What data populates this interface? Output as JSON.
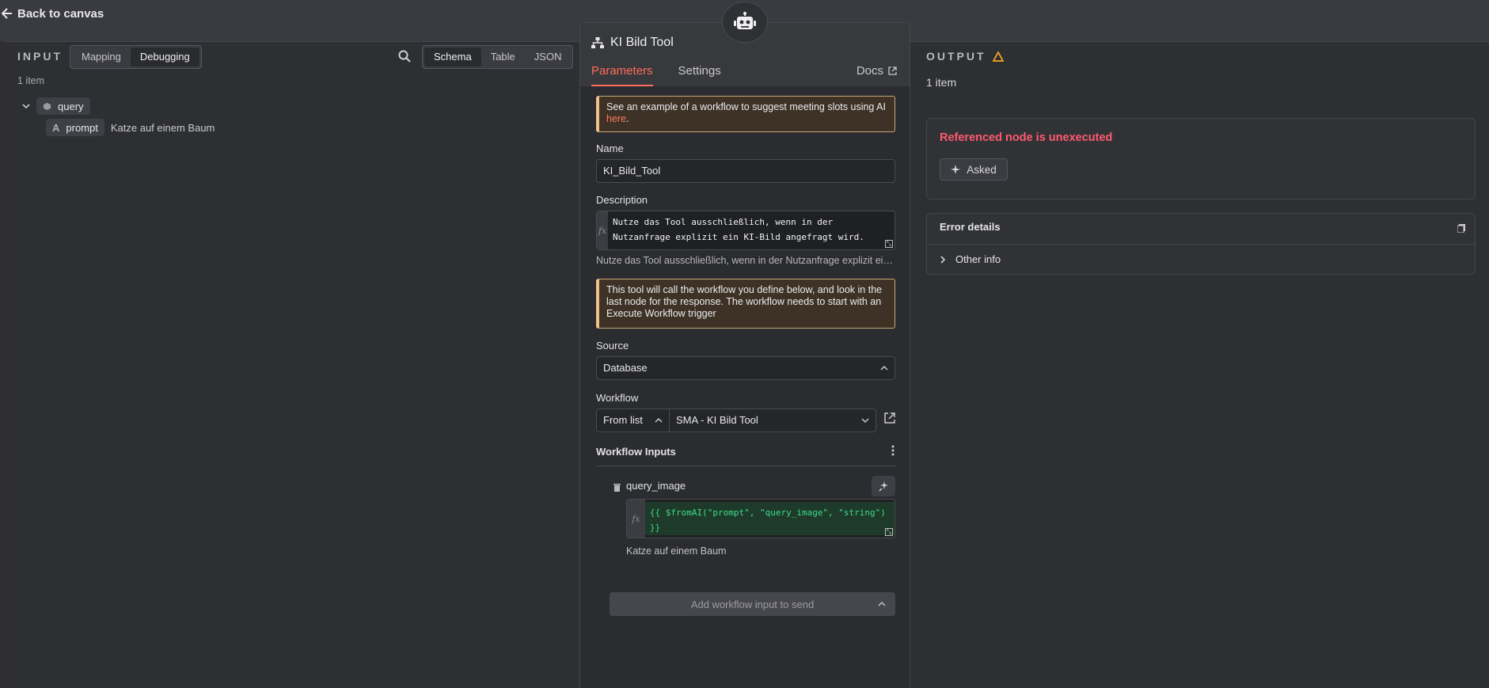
{
  "topbar": {
    "back_label": "Back to canvas"
  },
  "input": {
    "title": "INPUT",
    "mode_options": [
      "Mapping",
      "Debugging"
    ],
    "active_mode": "Debugging",
    "view_options": [
      "Schema",
      "Table",
      "JSON"
    ],
    "active_view": "Schema",
    "item_count": "1 item",
    "tree": {
      "root_label": "query",
      "child_type": "A",
      "child_label": "prompt",
      "child_value": "Katze auf einem Baum"
    }
  },
  "node": {
    "title": "KI Bild Tool",
    "tabs": [
      "Parameters",
      "Settings"
    ],
    "active_tab": "Parameters",
    "docs_label": "Docs",
    "notice1": {
      "text": "See an example of a workflow to suggest meeting slots using AI ",
      "link": "here",
      "suffix": "."
    },
    "name_label": "Name",
    "name_value": "KI_Bild_Tool",
    "description_label": "Description",
    "description_expr": "Nutze das Tool ausschließlich, wenn in der Nutzanfrage explizit ein KI-Bild angefragt wird.",
    "description_hint": "Nutze das Tool ausschließlich, wenn in der Nutzanfrage explizit ein KI-Bild angefragt wird.",
    "notice2": "This tool will call the workflow you define below, and look in the last node for the response. The workflow needs to start with an Execute Workflow trigger",
    "source_label": "Source",
    "source_value": "Database",
    "workflow_label": "Workflow",
    "workflow_mode": "From list",
    "workflow_value": "SMA - KI Bild Tool",
    "inputs_label": "Workflow Inputs",
    "input_field_name": "query_image",
    "input_expr": "{{ $fromAI(\"prompt\", \"query_image\", \"string\") }}",
    "input_hint": "Katze auf einem Baum",
    "add_input_label": "Add workflow input to send"
  },
  "output": {
    "title": "OUTPUT",
    "item_count": "1 item",
    "error_title": "Referenced node is unexecuted",
    "asked_label": "Asked",
    "error_details_label": "Error details",
    "other_info_label": "Other info"
  },
  "colors": {
    "accent": "#ff6d5a",
    "error": "#ff5a6e",
    "warning": "#f5a623",
    "expr_green": "#3ddc84"
  }
}
